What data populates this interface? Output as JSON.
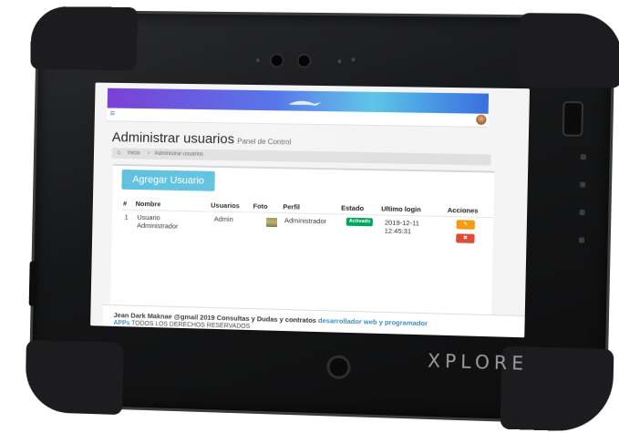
{
  "device": {
    "brand": "XPLORE"
  },
  "app": {
    "menu_icon": "hamburger-menu-icon",
    "page_title": "Administrar usuarios",
    "page_subtitle": "Panel de Control",
    "breadcrumb": {
      "home_icon": "home-icon",
      "home_label": "Inicio",
      "separator": ">",
      "current": "Administrar usuarios"
    },
    "add_button_label": "Agregar Usuario",
    "table": {
      "headers": [
        "#",
        "Nombre",
        "Usuarios",
        "Foto",
        "Perfil",
        "Estado",
        "Ultimo login",
        "Acciones"
      ],
      "rows": [
        {
          "index": "1",
          "nombre_line1": "Usuario",
          "nombre_line2": "Administrador",
          "usuario": "Admin",
          "perfil": "Administrador",
          "estado": "Activado",
          "login_date": "2019-12-11",
          "login_time": "12:45:31"
        }
      ]
    },
    "actions": {
      "edit_icon": "pencil-icon",
      "delete_icon": "close-icon"
    },
    "footer": {
      "line1_text": "Jean Dark Maknae @gmail 2019 Consultas y Dudas y contratos ",
      "line1_link": "desarrollador web y programador",
      "line2_app": "APPs",
      "line2_text": " TODOS LOS DERECHOS RESERVADOS"
    }
  },
  "colors": {
    "add_button": "#5bc0de",
    "badge_active": "#00a65a",
    "edit_button": "#f39c12",
    "delete_button": "#dd4b39",
    "link": "#3c8dbc"
  }
}
